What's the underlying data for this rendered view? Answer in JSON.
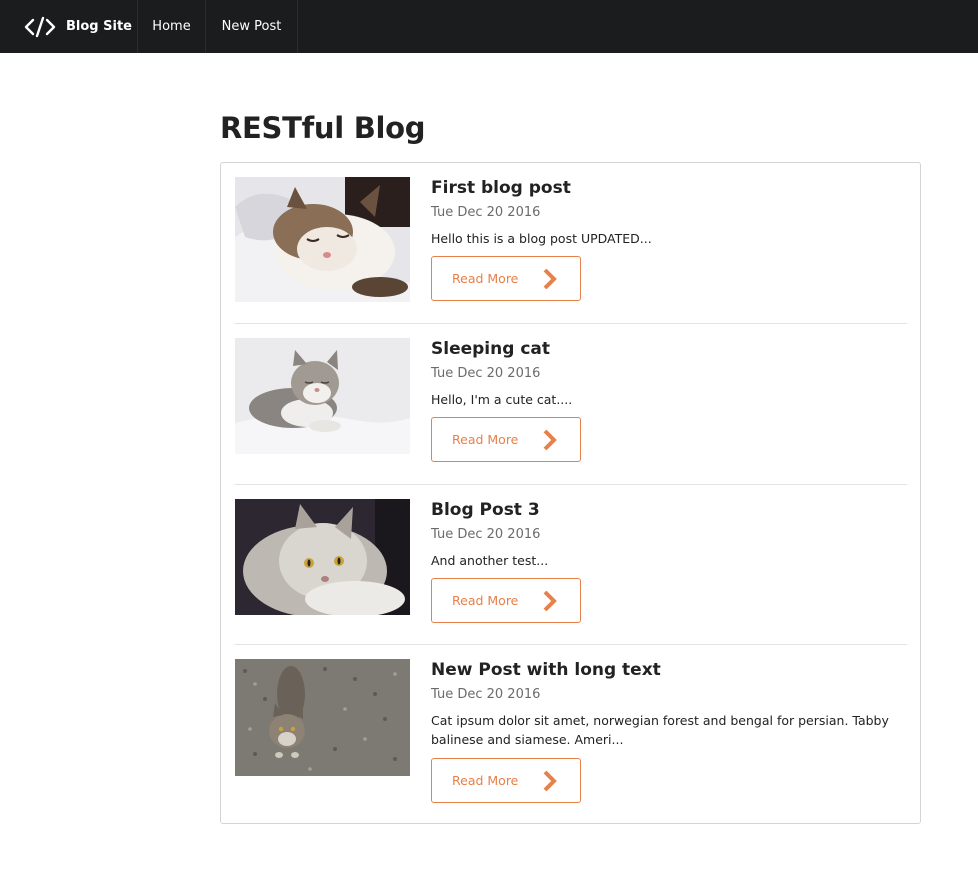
{
  "nav": {
    "brand": "Blog Site",
    "items": [
      {
        "label": "Home"
      },
      {
        "label": "New Post"
      }
    ],
    "brand_icon": "code-icon"
  },
  "page": {
    "title": "RESTful Blog"
  },
  "colors": {
    "nav_bg": "#1b1c1d",
    "accent": "#e8804a",
    "date": "#6b6b6b"
  },
  "posts": [
    {
      "title": "First blog post",
      "date": "Tue Dec 20 2016",
      "excerpt": "Hello this is a blog post UPDATED...",
      "button_label": "Read More",
      "image": "cat-sleeping-on-blanket"
    },
    {
      "title": "Sleeping cat",
      "date": "Tue Dec 20 2016",
      "excerpt": "Hello, I'm a cute cat....",
      "button_label": "Read More",
      "image": "cat-resting-white"
    },
    {
      "title": "Blog Post 3",
      "date": "Tue Dec 20 2016",
      "excerpt": "And another test...",
      "button_label": "Read More",
      "image": "fluffy-cat-dark"
    },
    {
      "title": "New Post with long text",
      "date": "Tue Dec 20 2016",
      "excerpt": "Cat ipsum dolor sit amet, norwegian forest and bengal for persian. Tabby balinese and siamese. Ameri...",
      "button_label": "Read More",
      "image": "tabby-cat-gravel"
    }
  ]
}
